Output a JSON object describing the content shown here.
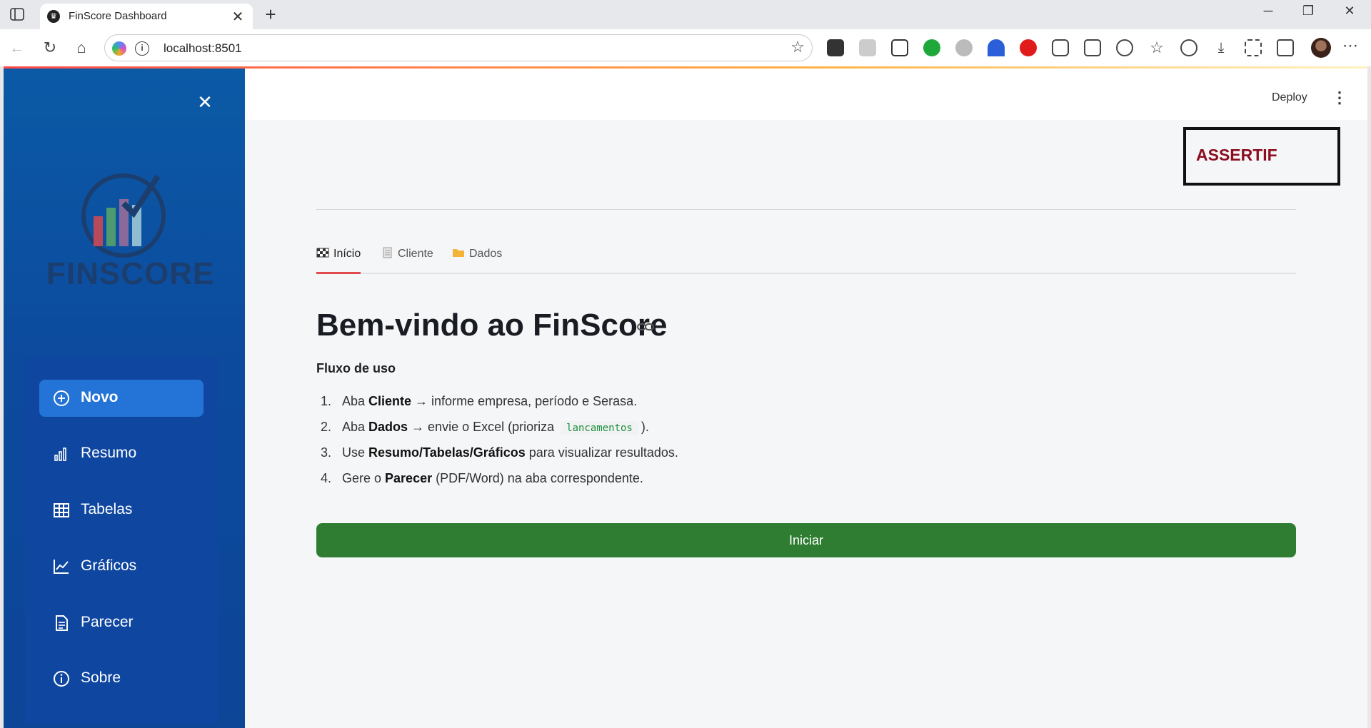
{
  "browser": {
    "tab_title": "FinScore Dashboard",
    "url": "localhost:8501",
    "new_tab_symbol": "+",
    "close_symbol": "✕"
  },
  "sidebar": {
    "logo_text": "FINSCORE",
    "close_symbol": "✕",
    "items": [
      {
        "label": "Novo",
        "icon": "plus-circle-icon",
        "active": true
      },
      {
        "label": "Resumo",
        "icon": "bar-chart-icon",
        "active": false
      },
      {
        "label": "Tabelas",
        "icon": "table-icon",
        "active": false
      },
      {
        "label": "Gráficos",
        "icon": "line-chart-icon",
        "active": false
      },
      {
        "label": "Parecer",
        "icon": "document-icon",
        "active": false
      },
      {
        "label": "Sobre",
        "icon": "info-icon",
        "active": false
      }
    ],
    "colors": {
      "background": "#0c4a9e",
      "active_item": "#2473d6"
    }
  },
  "header": {
    "deploy_label": "Deploy",
    "more_symbol": "⋮"
  },
  "brand": {
    "name": "ASSERTIF",
    "color": "#8b0d1f"
  },
  "tabs": [
    {
      "label": "Início",
      "icon": "checkered-flag-icon",
      "active": true
    },
    {
      "label": "Cliente",
      "icon": "notepad-icon",
      "active": false
    },
    {
      "label": "Dados",
      "icon": "folder-icon",
      "active": false
    }
  ],
  "content": {
    "title": "Bem-vindo ao FinScore",
    "flow_title": "Fluxo de uso",
    "steps": [
      {
        "num": "1.",
        "pre": "Aba ",
        "bold": "Cliente",
        "post": " → informe empresa, período e Serasa."
      },
      {
        "num": "2.",
        "pre": "Aba ",
        "bold": "Dados",
        "post": " → envie o Excel (prioriza",
        "code": "lancamentos",
        "after": ")."
      },
      {
        "num": "3.",
        "pre": "Use ",
        "bold": "Resumo/Tabelas/Gráficos",
        "post": " para visualizar resultados."
      },
      {
        "num": "4.",
        "pre": "Gere o ",
        "bold": "Parecer",
        "post": " (PDF/Word) na aba correspondente."
      }
    ],
    "start_button": "Iniciar",
    "start_button_color": "#2e7d32"
  }
}
